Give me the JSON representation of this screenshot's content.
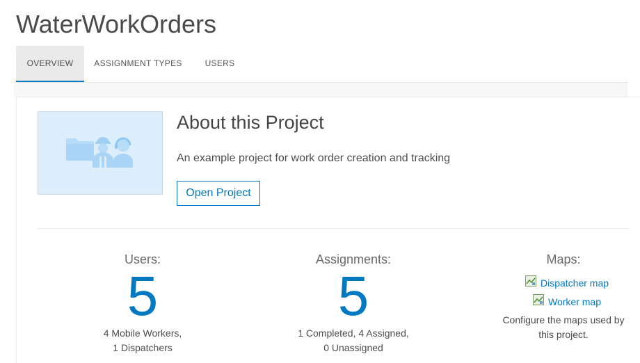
{
  "app": {
    "title": "WaterWorkOrders"
  },
  "tabs": [
    {
      "label": "OVERVIEW",
      "active": true
    },
    {
      "label": "ASSIGNMENT TYPES",
      "active": false
    },
    {
      "label": "USERS",
      "active": false
    }
  ],
  "about": {
    "title": "About this Project",
    "description": "An example project for work order creation and tracking",
    "open_button": "Open Project",
    "thumbnail_icon": "workforce-project-icon"
  },
  "stats": {
    "users": {
      "label": "Users:",
      "value": "5",
      "line1": "4 Mobile Workers,",
      "line2": "1 Dispatchers"
    },
    "assignments": {
      "label": "Assignments:",
      "value": "5",
      "line1": "1 Completed, 4 Assigned,",
      "line2": "0 Unassigned"
    },
    "maps": {
      "label": "Maps:",
      "links": [
        {
          "label": "Dispatcher map",
          "icon": "map-icon"
        },
        {
          "label": "Worker map",
          "icon": "map-icon"
        }
      ],
      "line1": "Configure the maps used by",
      "line2": "this project."
    }
  },
  "colors": {
    "accent": "#0079c1",
    "thumbnail_bg": "#dceefb",
    "tab_active_bg": "#eaeaea"
  }
}
